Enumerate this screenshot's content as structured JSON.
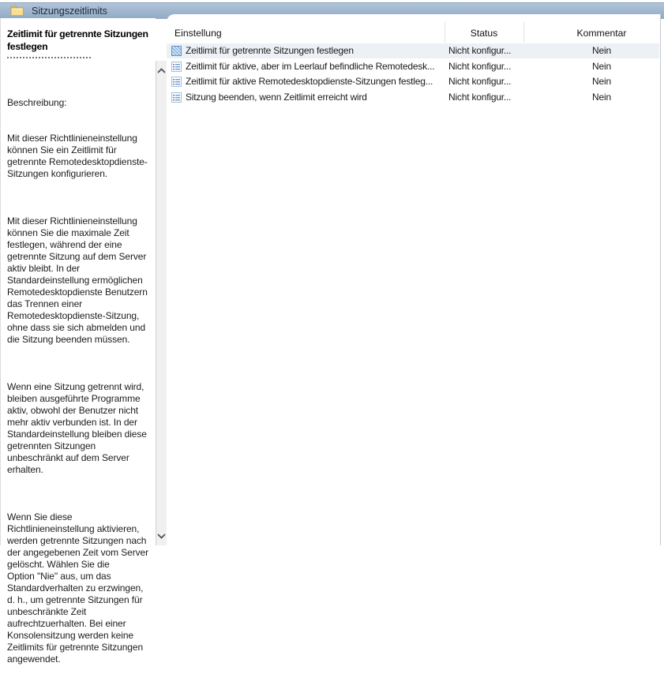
{
  "header": {
    "title": "Sitzungszeitlimits"
  },
  "left_pane": {
    "setting_title": "Zeitlimit für getrennte Sitzungen\nfestlegen",
    "description_label": "Beschreibung:",
    "paragraphs": [
      "Mit dieser Richtlinieneinstellung\nkönnen Sie ein Zeitlimit für\ngetrennte Remotedesktopdienste-\nSitzungen konfigurieren.",
      "Mit dieser Richtlinieneinstellung\nkönnen Sie die maximale Zeit\nfestlegen, während der eine\ngetrennte Sitzung auf dem Server\naktiv bleibt. In der\nStandardeinstellung ermöglichen\nRemotedesktopdienste Benutzern\ndas Trennen einer\nRemotedesktopdienste-Sitzung,\nohne dass sie sich abmelden und\ndie Sitzung beenden müssen.",
      "Wenn eine Sitzung getrennt wird,\nbleiben ausgeführte Programme\naktiv, obwohl der Benutzer nicht\nmehr aktiv verbunden ist. In der\nStandardeinstellung bleiben diese\ngetrennten Sitzungen\nunbeschränkt auf dem Server\nerhalten.",
      "Wenn Sie diese\nRichtlinieneinstellung aktivieren,\nwerden getrennte Sitzungen nach\nder angegebenen Zeit vom Server\ngelöscht. Wählen Sie die\nOption \"Nie\" aus, um das\nStandardverhalten zu erzwingen,\nd. h., um getrennte Sitzungen für\nunbeschränkte Zeit\naufrechtzuerhalten. Bei einer\nKonsolensitzung werden keine\nZeitlimits für getrennte Sitzungen\nangewendet."
    ]
  },
  "scrollbar": {
    "up_icon": "chevron-up",
    "down_icon": "chevron-down"
  },
  "table": {
    "columns": [
      "Einstellung",
      "Status",
      "Kommentar"
    ],
    "rows": [
      {
        "icon": "selected-setting-icon",
        "setting": "Zeitlimit für getrennte Sitzungen festlegen",
        "status": "Nicht konfigur...",
        "comment": "Nein",
        "selected": true
      },
      {
        "icon": "setting-list-icon",
        "setting": "Zeitlimit für aktive, aber im Leerlauf befindliche Remotedesk...",
        "status": "Nicht konfigur...",
        "comment": "Nein",
        "selected": false
      },
      {
        "icon": "setting-list-icon",
        "setting": "Zeitlimit für aktive Remotedesktopdienste-Sitzungen festleg...",
        "status": "Nicht konfigur...",
        "comment": "Nein",
        "selected": false
      },
      {
        "icon": "setting-list-icon",
        "setting": "Sitzung beenden, wenn Zeitlimit erreicht wird",
        "status": "Nicht konfigur...",
        "comment": "Nein",
        "selected": false
      }
    ]
  },
  "colors": {
    "header_bar_top": "#b0c4da",
    "header_bar_bottom": "#92aac4",
    "header_text": "#1d2b3a",
    "selected_row_bg": "#edf1f6",
    "scroll_track": "#f0f0f0",
    "folder_icon_fill": "#f6e096",
    "body_text": "#1a1a1a"
  }
}
